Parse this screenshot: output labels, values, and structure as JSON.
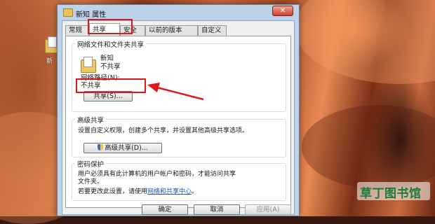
{
  "desktop": {
    "icon_label": "新"
  },
  "window": {
    "title": "新知 属性",
    "close_label": "✕",
    "tabs": [
      "常规",
      "共享",
      "安全",
      "以前的版本",
      "自定义"
    ],
    "active_tab": "共享"
  },
  "network_share": {
    "title": "网络文件和文件夹共享",
    "folder_name": "新知",
    "folder_status": "不共享",
    "path_label": "网络路径(N):",
    "path_value": "不共享",
    "share_button": "共享(S)..."
  },
  "advanced_share": {
    "title": "高级共享",
    "description": "设置自定义权限，创建多个共享，并设置其他高级共享选项。",
    "description_wrap": "项。",
    "button": "高级共享(D)..."
  },
  "password": {
    "title": "密码保护",
    "line1": "用户必须具有此计算机的用户帐户和密码，才能访问共享",
    "line2": "文件夹。",
    "line3_prefix": "若要更改此设置，请使用",
    "link": "网络和共享中心",
    "line3_suffix": "。"
  },
  "footer": {
    "ok": "确定",
    "cancel": "取消",
    "apply": "应用(A)"
  },
  "watermark": {
    "text": "草丁图书馆"
  },
  "colors": {
    "highlight": "#e0161b",
    "link": "#1a55c0",
    "watermark": "#1e7a3a"
  }
}
